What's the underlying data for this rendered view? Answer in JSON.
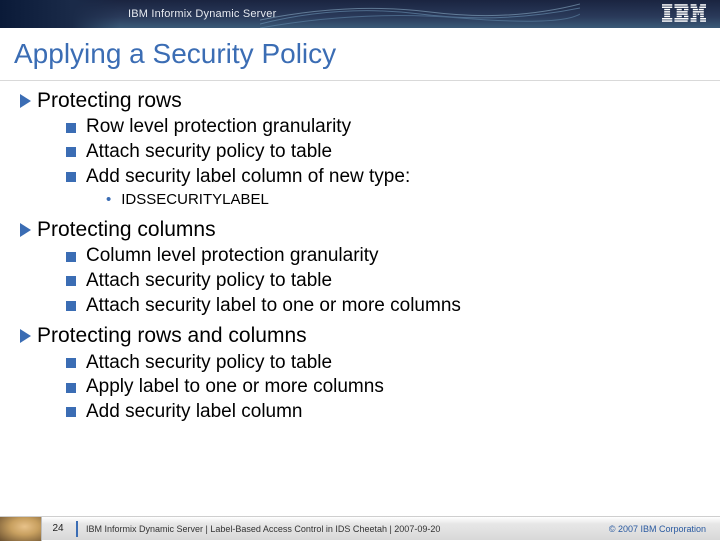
{
  "header": {
    "product_name": "IBM Informix Dynamic Server",
    "logo_label": "IBM"
  },
  "title": "Applying a Security Policy",
  "sections": [
    {
      "heading": "Protecting rows",
      "items": [
        "Row level protection granularity",
        "Attach security policy to table",
        "Add security label column of new type:"
      ],
      "subitems": [
        "IDSSECURITYLABEL"
      ]
    },
    {
      "heading": "Protecting columns",
      "items": [
        "Column level protection granularity",
        "Attach security policy to table",
        "Attach security label to one or more columns"
      ],
      "subitems": []
    },
    {
      "heading": "Protecting rows and columns",
      "items": [
        "Attach security policy to table",
        "Apply label to one or more columns",
        "Add security label column"
      ],
      "subitems": []
    }
  ],
  "footer": {
    "page_number": "24",
    "text": "IBM Informix Dynamic Server  |  Label-Based Access Control in IDS Cheetah | 2007-09-20",
    "copyright": "© 2007 IBM Corporation"
  }
}
